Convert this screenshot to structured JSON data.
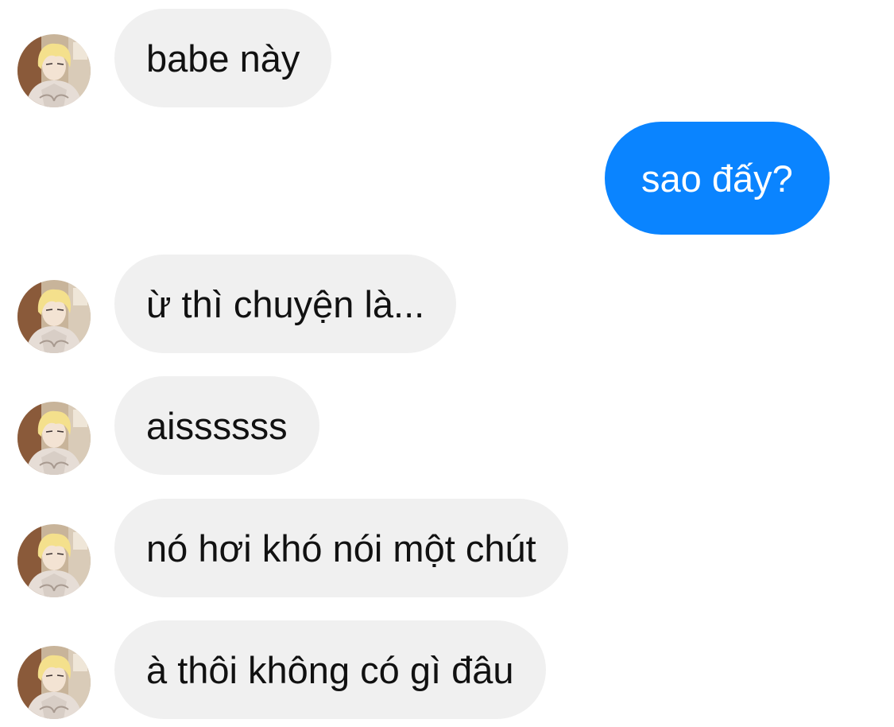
{
  "colors": {
    "incoming_bubble": "#f0f0f0",
    "outgoing_bubble": "#0a84ff",
    "incoming_text": "#111111",
    "outgoing_text": "#ffffff"
  },
  "messages": [
    {
      "sender": "other",
      "text": "babe này",
      "avatar": "contact-avatar"
    },
    {
      "sender": "me",
      "text": "sao đấy?"
    },
    {
      "sender": "other",
      "text": "ừ thì chuyện là...",
      "avatar": "contact-avatar"
    },
    {
      "sender": "other",
      "text": "aissssss",
      "avatar": "contact-avatar"
    },
    {
      "sender": "other",
      "text": "nó hơi khó nói một chút",
      "avatar": "contact-avatar"
    },
    {
      "sender": "other",
      "text": "à thôi không có gì đâu",
      "avatar": "contact-avatar"
    }
  ]
}
